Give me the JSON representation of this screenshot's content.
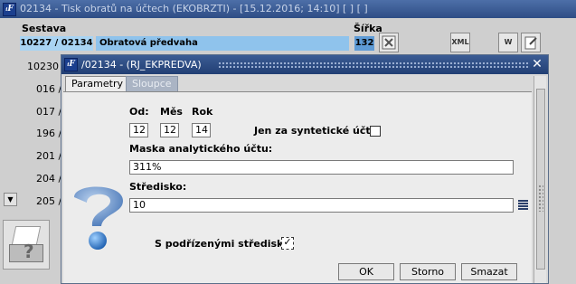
{
  "background": {
    "title": "02134 - Tisk obratů na účtech (EKOBRZTI) - [15.12.2016; 14:10]  [ ]  [ ]",
    "columns": {
      "sestava": "Sestava",
      "sirka": "Šířka"
    },
    "selected_row": {
      "code": "10227 / 02134",
      "name": "Obratová předvaha",
      "width": "132"
    },
    "row_codes": [
      "10230 /",
      "016 /",
      "017 /",
      "196 /",
      "201 /",
      "204 /",
      "205 /"
    ],
    "toolbar_icons": [
      "excel-icon",
      "xml-icon",
      "word-icon",
      "edit-icon"
    ],
    "toolbar_labels": {
      "xml": "XML",
      "word": "W"
    }
  },
  "dialog": {
    "title": "/02134 - (RJ_EKPREDVA)",
    "tabs": [
      {
        "label": "Parametry",
        "active": true
      },
      {
        "label": "Sloupce",
        "active": false
      }
    ],
    "labels": {
      "od": "Od:",
      "mes": "Měs",
      "rok": "Rok",
      "synteticke": "Jen za syntetické účty:",
      "maska": "Maska analytického účtu:",
      "stredisko": "Středisko:",
      "podrizene": "S podřízenými středisky:"
    },
    "values": {
      "od": "12",
      "mes": "12",
      "rok": "14",
      "maska": "311%",
      "stredisko": "10",
      "synteticke_checked": "",
      "podrizene_checked": "✓"
    },
    "buttons": {
      "ok": "OK",
      "storno": "Storno",
      "smazat": "Smazat"
    }
  },
  "colors": {
    "title_bar": "#2e4d85",
    "selection": "#8fc3ec",
    "width_highlight": "#5e9bd6"
  }
}
